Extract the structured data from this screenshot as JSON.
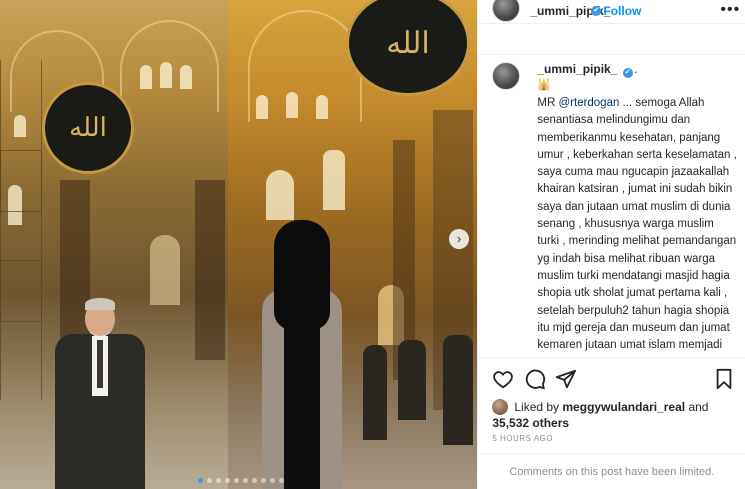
{
  "post": {
    "username": "_ummi_pipik_",
    "follow_label": "Follow",
    "more_label": "•••",
    "verified_glyph": "✔",
    "caption_emoji": "🕌",
    "caption_mention": "@rterdogan",
    "caption_prefix": "MR ",
    "caption_rest": " ... semoga Allah senantiasa melindungimu dan memberikanmu kesehatan, panjang umur , keberkahan serta keselamatan , saya cuma mau ngucapin jazaakallah khairan katsiran , jumat ini sudah bikin saya dan jutaan umat muslim di dunia senang , khususnya warga muslim turki , merinding melihat pemandangan yg indah bisa melihat ribuan warga muslim turki mendatangi masjid hagia shopia utk sholat jumat pertama kali , setelah berpuluh2 tahun hagia shopia itu mjd gereja dan museum dan jumat kemaren jutaan umat islam memjadi saksi atas pemandangan dan suara takbir yg",
    "liked_by_prefix": "Liked by ",
    "liked_by_user": "meggywulandari_real",
    "liked_by_suffix": " and",
    "likes_count": "35,532 others",
    "timestamp": "5 HOURS AGO",
    "comments_limited": "Comments on this post have been limited."
  },
  "media": {
    "medallion_text": "الله",
    "carousel_next_glyph": "›",
    "slide_count": 10,
    "active_slide": 0
  },
  "icons": [
    "heart-icon",
    "comment-icon",
    "share-icon",
    "bookmark-icon"
  ],
  "colors": {
    "accent": "#0095f6",
    "verified": "#3897f0",
    "text": "#262626",
    "muted": "#8e8e8e"
  }
}
